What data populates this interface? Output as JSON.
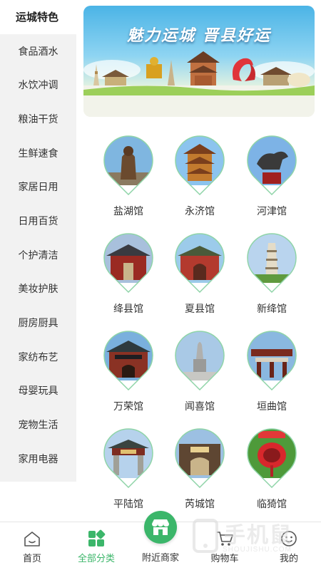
{
  "sidebar": {
    "items": [
      {
        "label": "运城特色",
        "active": true
      },
      {
        "label": "食品酒水",
        "active": false
      },
      {
        "label": "水饮冲调",
        "active": false
      },
      {
        "label": "粮油干货",
        "active": false
      },
      {
        "label": "生鲜速食",
        "active": false
      },
      {
        "label": "家居日用",
        "active": false
      },
      {
        "label": "日用百货",
        "active": false
      },
      {
        "label": "个护清洁",
        "active": false
      },
      {
        "label": "美妆护肤",
        "active": false
      },
      {
        "label": "厨房厨具",
        "active": false
      },
      {
        "label": "家纺布艺",
        "active": false
      },
      {
        "label": "母婴玩具",
        "active": false
      },
      {
        "label": "宠物生活",
        "active": false
      },
      {
        "label": "家用电器",
        "active": false
      }
    ]
  },
  "banner": {
    "title": "魅力运城 晋县好运"
  },
  "pavilions": [
    {
      "label": "盐湖馆",
      "icon": "guan-yu-statue"
    },
    {
      "label": "永济馆",
      "icon": "tower-pavilion"
    },
    {
      "label": "河津馆",
      "icon": "horse-statue"
    },
    {
      "label": "绛县馆",
      "icon": "temple-gate"
    },
    {
      "label": "夏县馆",
      "icon": "red-gate"
    },
    {
      "label": "新绛馆",
      "icon": "pagoda"
    },
    {
      "label": "万荣馆",
      "icon": "gate-tower"
    },
    {
      "label": "闻喜馆",
      "icon": "standing-statue"
    },
    {
      "label": "垣曲馆",
      "icon": "memorial-gate"
    },
    {
      "label": "平陆馆",
      "icon": "archway"
    },
    {
      "label": "芮城馆",
      "icon": "palace-gate"
    },
    {
      "label": "临猗馆",
      "icon": "red-sculpture"
    }
  ],
  "tabbar": {
    "home": "首页",
    "categories": "全部分类",
    "nearby": "附近商家",
    "cart": "购物车",
    "mine": "我的"
  },
  "watermark": {
    "main": "手机鼠",
    "sub": "SHOUJISHU.COM"
  },
  "colors": {
    "accent": "#3bb66a",
    "sidebar_bg": "#f2f2f2",
    "text": "#333333"
  }
}
